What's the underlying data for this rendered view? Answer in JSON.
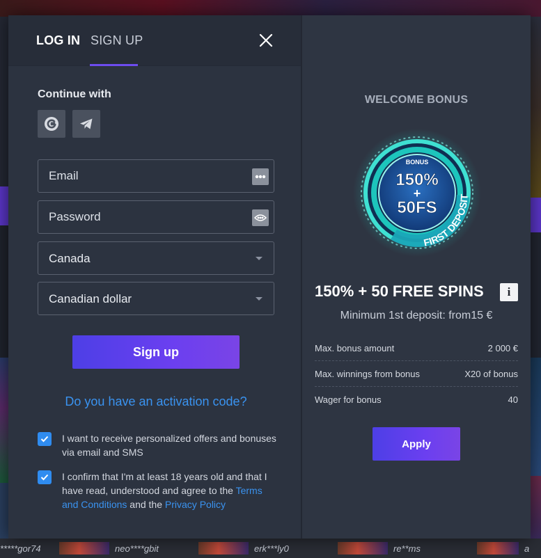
{
  "tabs": {
    "login": "LOG IN",
    "signup": "SIGN UP",
    "active": "signup"
  },
  "continue_with": "Continue with",
  "social": [
    {
      "name": "google",
      "icon": "google-icon"
    },
    {
      "name": "telegram",
      "icon": "telegram-icon"
    }
  ],
  "form": {
    "email_placeholder": "Email",
    "password_placeholder": "Password",
    "country": "Canada",
    "currency": "Canadian dollar",
    "signup_label": "Sign up"
  },
  "activation_link": "Do you have an activation code?",
  "consents": {
    "offers": "I want to receive personalized offers and bonuses via email and SMS",
    "offers_checked": true,
    "age_prefix": "I confirm that I'm at least 18 years old and that I have read, understood and agree to the",
    "terms_link": "Terms and Conditions",
    "and": "and the",
    "privacy_link": "Privacy Policy",
    "age_checked": true
  },
  "bonus": {
    "title": "WELCOME BONUS",
    "badge_top": "BONUS",
    "badge_line1": "150%",
    "badge_plus": "+",
    "badge_line2": "50FS",
    "badge_arc": "FIRST DEPOSIT",
    "headline": "150% + 50 FREE SPINS",
    "info_icon": "i",
    "min_deposit": "Minimum 1st deposit: from15 €",
    "terms": [
      {
        "label": "Max. bonus amount",
        "value": "2 000 €"
      },
      {
        "label": "Max. winnings from bonus",
        "value": "X20 of bonus"
      },
      {
        "label": "Wager for bonus",
        "value": "40"
      }
    ],
    "apply_label": "Apply"
  },
  "winners": [
    "*****gor74",
    "neo****gbit",
    "erk***ly0",
    "re**ms",
    "a"
  ],
  "colors": {
    "accent": "#6b3ff0",
    "link": "#3a93f0",
    "panel": "#2c3340",
    "checkbox": "#2f8cf0"
  }
}
